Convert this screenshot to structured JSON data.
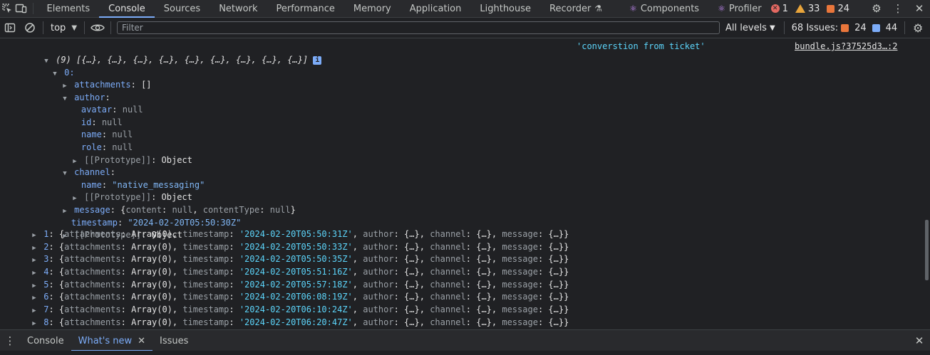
{
  "tabbar": {
    "tabs": [
      "Elements",
      "Console",
      "Sources",
      "Network",
      "Performance",
      "Memory",
      "Application",
      "Lighthouse",
      "Recorder"
    ],
    "ext_tabs": [
      "Components",
      "Profiler"
    ],
    "errors": "1",
    "warnings": "33",
    "issues": "24"
  },
  "toolbar": {
    "context": "top",
    "filter_placeholder": "Filter",
    "levels": "All levels",
    "issues_label": "68 Issues:",
    "issues_orange": "24",
    "issues_blue": "44"
  },
  "console": {
    "summary": "(9) [{…}, {…}, {…}, {…}, {…}, {…}, {…}, {…}, {…}]",
    "message": "'converstion from ticket'",
    "source": "bundle.js?37525d3…:2",
    "item0": {
      "index": "0:",
      "attachments_key": "attachments",
      "attachments_val": "[]",
      "author_key": "author",
      "author_fields": [
        {
          "key": "avatar",
          "val": "null"
        },
        {
          "key": "id",
          "val": "null"
        },
        {
          "key": "name",
          "val": "null"
        },
        {
          "key": "role",
          "val": "null"
        }
      ],
      "proto_label": "[[Prototype]]",
      "proto_val": "Object",
      "channel_key": "channel",
      "channel_name_key": "name",
      "channel_name_val": "\"native_messaging\"",
      "message_key": "message",
      "message_val_open": "{",
      "message_content_key": "content",
      "message_content_val": "null",
      "message_ct_key": "contentType",
      "message_ct_val": "null",
      "message_val_close": "}",
      "timestamp_key": "timestamp",
      "timestamp_val": "\"2024-02-20T05:50:30Z\""
    },
    "rows": [
      {
        "idx": "1",
        "ts": "'2024-02-20T05:50:31Z'"
      },
      {
        "idx": "2",
        "ts": "'2024-02-20T05:50:33Z'"
      },
      {
        "idx": "3",
        "ts": "'2024-02-20T05:50:35Z'"
      },
      {
        "idx": "4",
        "ts": "'2024-02-20T05:51:16Z'"
      },
      {
        "idx": "5",
        "ts": "'2024-02-20T05:57:18Z'"
      },
      {
        "idx": "6",
        "ts": "'2024-02-20T06:08:19Z'"
      },
      {
        "idx": "7",
        "ts": "'2024-02-20T06:10:24Z'"
      },
      {
        "idx": "8",
        "ts": "'2024-02-20T06:20:47Z'"
      }
    ],
    "row_parts": {
      "attachments": "attachments",
      "array0": "Array(0)",
      "timestamp": "timestamp",
      "author": "author",
      "channel": "channel",
      "message": "message",
      "collapsed": "{…}"
    }
  },
  "drawer": {
    "tabs": [
      "Console",
      "What's new",
      "Issues"
    ]
  }
}
